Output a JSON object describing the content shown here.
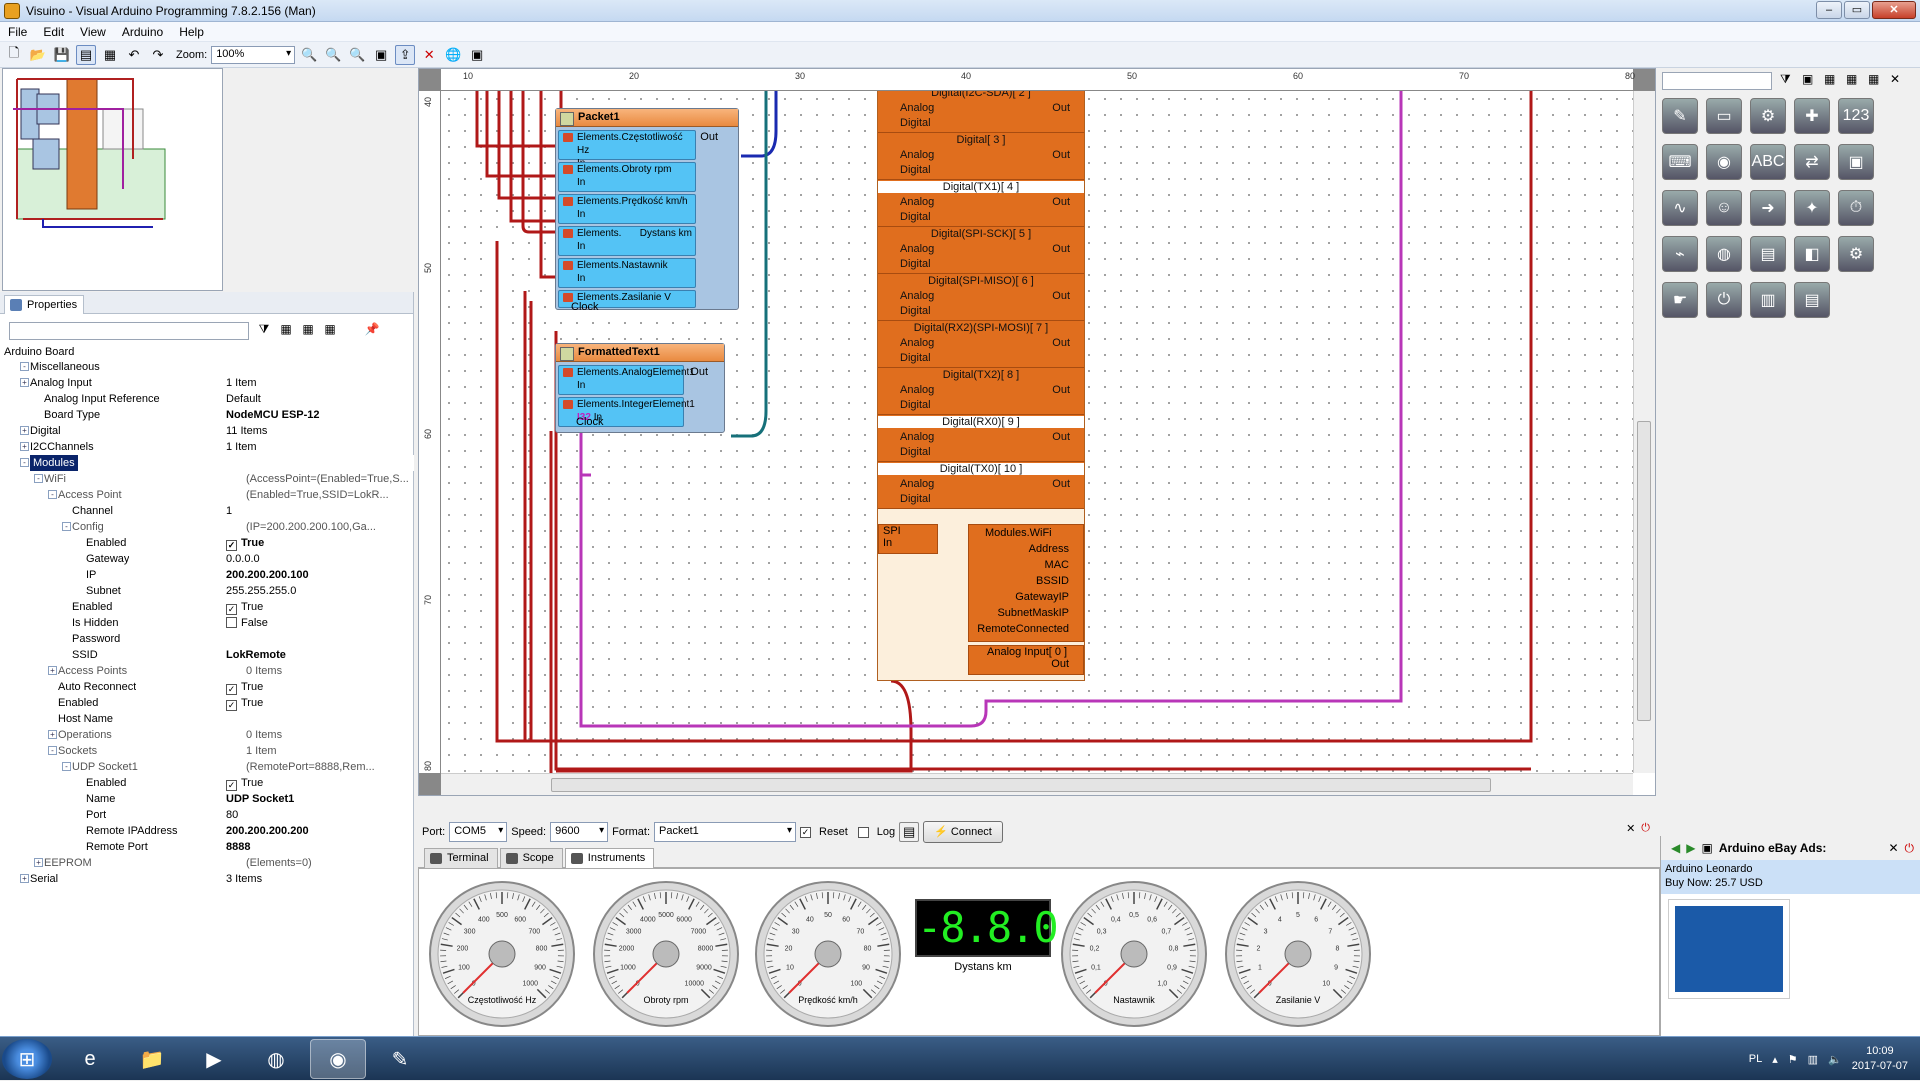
{
  "window": {
    "title": "Visuino - Visual Arduino Programming 7.8.2.156 (Man)"
  },
  "menu": [
    "File",
    "Edit",
    "View",
    "Arduino",
    "Help"
  ],
  "toolbar": {
    "zoom_label": "Zoom:",
    "zoom_value": "100%"
  },
  "properties": {
    "tab_label": "Properties",
    "root": "Arduino Board",
    "rows": [
      {
        "name": "Miscellaneous",
        "value": "",
        "indent": 0,
        "exp": "-",
        "lite": false
      },
      {
        "name": "Analog Input",
        "value": "1 Item",
        "indent": 0,
        "exp": "+",
        "lite": false
      },
      {
        "name": "Analog Input Reference",
        "value": "Default",
        "indent": 1,
        "exp": "",
        "lite": false
      },
      {
        "name": "Board Type",
        "value": "NodeMCU ESP-12",
        "indent": 1,
        "exp": "",
        "lite": false,
        "bold": true
      },
      {
        "name": "Digital",
        "value": "11 Items",
        "indent": 0,
        "exp": "+",
        "lite": false
      },
      {
        "name": "I2CChannels",
        "value": "1 Item",
        "indent": 0,
        "exp": "+",
        "lite": false
      },
      {
        "name": "Modules",
        "value": "",
        "indent": 0,
        "exp": "-",
        "lite": false,
        "sel": true
      },
      {
        "name": "WiFi",
        "value": "(AccessPoint=(Enabled=True,S...",
        "indent": 1,
        "exp": "-",
        "lite": true
      },
      {
        "name": "Access Point",
        "value": "(Enabled=True,SSID=LokR...",
        "indent": 2,
        "exp": "-",
        "lite": true
      },
      {
        "name": "Channel",
        "value": "1",
        "indent": 3,
        "exp": "",
        "lite": false
      },
      {
        "name": "Config",
        "value": "(IP=200.200.200.100,Ga...",
        "indent": 3,
        "exp": "-",
        "lite": true
      },
      {
        "name": "Enabled",
        "value": "True",
        "indent": 4,
        "exp": "",
        "lite": false,
        "check": true,
        "bold": true
      },
      {
        "name": "Gateway",
        "value": "0.0.0.0",
        "indent": 4,
        "exp": "",
        "lite": false
      },
      {
        "name": "IP",
        "value": "200.200.200.100",
        "indent": 4,
        "exp": "",
        "lite": false,
        "bold": true
      },
      {
        "name": "Subnet",
        "value": "255.255.255.0",
        "indent": 4,
        "exp": "",
        "lite": false
      },
      {
        "name": "Enabled",
        "value": "True",
        "indent": 3,
        "exp": "",
        "lite": false,
        "check": true
      },
      {
        "name": "Is Hidden",
        "value": "False",
        "indent": 3,
        "exp": "",
        "lite": false,
        "check": false
      },
      {
        "name": "Password",
        "value": "",
        "indent": 3,
        "exp": "",
        "lite": false
      },
      {
        "name": "SSID",
        "value": "LokRemote",
        "indent": 3,
        "exp": "",
        "lite": false,
        "bold": true
      },
      {
        "name": "Access Points",
        "value": "0 Items",
        "indent": 2,
        "exp": "+",
        "lite": true
      },
      {
        "name": "Auto Reconnect",
        "value": "True",
        "indent": 2,
        "exp": "",
        "lite": false,
        "check": true
      },
      {
        "name": "Enabled",
        "value": "True",
        "indent": 2,
        "exp": "",
        "lite": false,
        "check": true
      },
      {
        "name": "Host Name",
        "value": "",
        "indent": 2,
        "exp": "",
        "lite": false
      },
      {
        "name": "Operations",
        "value": "0 Items",
        "indent": 2,
        "exp": "+",
        "lite": true
      },
      {
        "name": "Sockets",
        "value": "1 Item",
        "indent": 2,
        "exp": "-",
        "lite": true
      },
      {
        "name": "UDP Socket1",
        "value": "(RemotePort=8888,Rem...",
        "indent": 3,
        "exp": "-",
        "lite": true
      },
      {
        "name": "Enabled",
        "value": "True",
        "indent": 4,
        "exp": "",
        "lite": false,
        "check": true
      },
      {
        "name": "Name",
        "value": "UDP Socket1",
        "indent": 4,
        "exp": "",
        "lite": false,
        "bold": true
      },
      {
        "name": "Port",
        "value": "80",
        "indent": 4,
        "exp": "",
        "lite": false
      },
      {
        "name": "Remote IPAddress",
        "value": "200.200.200.200",
        "indent": 4,
        "exp": "",
        "lite": false,
        "bold": true
      },
      {
        "name": "Remote Port",
        "value": "8888",
        "indent": 4,
        "exp": "",
        "lite": false,
        "bold": true
      },
      {
        "name": "EEPROM",
        "value": "(Elements=0)",
        "indent": 1,
        "exp": "+",
        "lite": true
      },
      {
        "name": "Serial",
        "value": "3 Items",
        "indent": 0,
        "exp": "+",
        "lite": false
      }
    ]
  },
  "ruler": {
    "top": [
      "10",
      "20",
      "30",
      "40",
      "50",
      "60",
      "70",
      "80"
    ],
    "left": [
      "40",
      "50",
      "60",
      "70",
      "80"
    ]
  },
  "packet": {
    "title": "Packet1",
    "pins": [
      "Elements.Częstotliwość Hz",
      "Elements.Obroty rpm",
      "Elements.Prędkość km/h",
      "Elements.",
      "Elements.Nastawnik",
      "Elements.Zasilanie V"
    ],
    "pin4_extra": "Dystans km",
    "in_label": "In",
    "out_label": "Out",
    "clock_label": "Clock"
  },
  "formatted": {
    "title": "FormattedText1",
    "pins": [
      "Elements.AnalogElement1",
      "Elements.IntegerElement1"
    ],
    "in_label": "In",
    "int_tag": "I32",
    "out_label": "Out",
    "clock_label": "Clock"
  },
  "board": {
    "digitals": [
      "Digital(I2C-SDA)[ 2 ]",
      "Digital[ 3 ]",
      "Digital(TX1)[ 4 ]",
      "Digital(SPI-SCK)[ 5 ]",
      "Digital(SPI-MISO)[ 6 ]",
      "Digital(RX2)(SPI-MOSI)[ 7 ]",
      "Digital(TX2)[ 8 ]",
      "Digital(RX0)[ 9 ]",
      "Digital(TX0)[ 10 ]"
    ],
    "analog_label": "Analog",
    "digital_label": "Digital",
    "out_label": "Out",
    "spi": "SPI",
    "spi_in": "In",
    "wifi_title": "Modules.WiFi",
    "wifi_pins": [
      "Address",
      "MAC",
      "BSSID",
      "GatewayIP",
      "SubnetMaskIP",
      "RemoteConnected"
    ],
    "analog_input": "Analog Input[ 0 ]",
    "analog_out": "Out"
  },
  "serial": {
    "port_label": "Port:",
    "port": "COM5",
    "speed_label": "Speed:",
    "speed": "9600",
    "format_label": "Format:",
    "format": "Packet1",
    "reset_label": "Reset",
    "log_label": "Log",
    "connect_label": "Connect"
  },
  "tabs": [
    "Terminal",
    "Scope",
    "Instruments"
  ],
  "instruments": {
    "gauges": [
      {
        "label": "Częstotliwość Hz",
        "ticks": [
          "0",
          "100",
          "200",
          "300",
          "400",
          "500",
          "600",
          "700",
          "800",
          "900",
          "1000"
        ],
        "value_fraction": 0.0
      },
      {
        "label": "Obroty rpm",
        "ticks": [
          "0",
          "1000",
          "2000",
          "3000",
          "4000",
          "5000",
          "6000",
          "7000",
          "8000",
          "9000",
          "10000"
        ],
        "value_fraction": 0.0
      },
      {
        "label": "Prędkość km/h",
        "ticks": [
          "0",
          "10",
          "20",
          "30",
          "40",
          "50",
          "60",
          "70",
          "80",
          "90",
          "100"
        ],
        "value_fraction": 0.0
      },
      {
        "label": "Nastawnik",
        "ticks": [
          "0",
          "0,1",
          "0,2",
          "0,3",
          "0,4",
          "0,5",
          "0,6",
          "0,7",
          "0,8",
          "0,9",
          "1,0"
        ],
        "value_fraction": 0.0
      },
      {
        "label": "Zasilanie V",
        "ticks": [
          "0",
          "1",
          "2",
          "3",
          "4",
          "5",
          "6",
          "7",
          "8",
          "9",
          "10"
        ],
        "value_fraction": 0.0
      }
    ],
    "lcd_value": "-8.8.0.00",
    "lcd_label": "Dystans km"
  },
  "ads": {
    "title": "Arduino eBay Ads:",
    "item": "Arduino Leonardo",
    "price": "Buy Now: 25.7 USD"
  },
  "taskbar": {
    "lang": "PL",
    "time": "10:09",
    "date": "2017-07-07"
  }
}
